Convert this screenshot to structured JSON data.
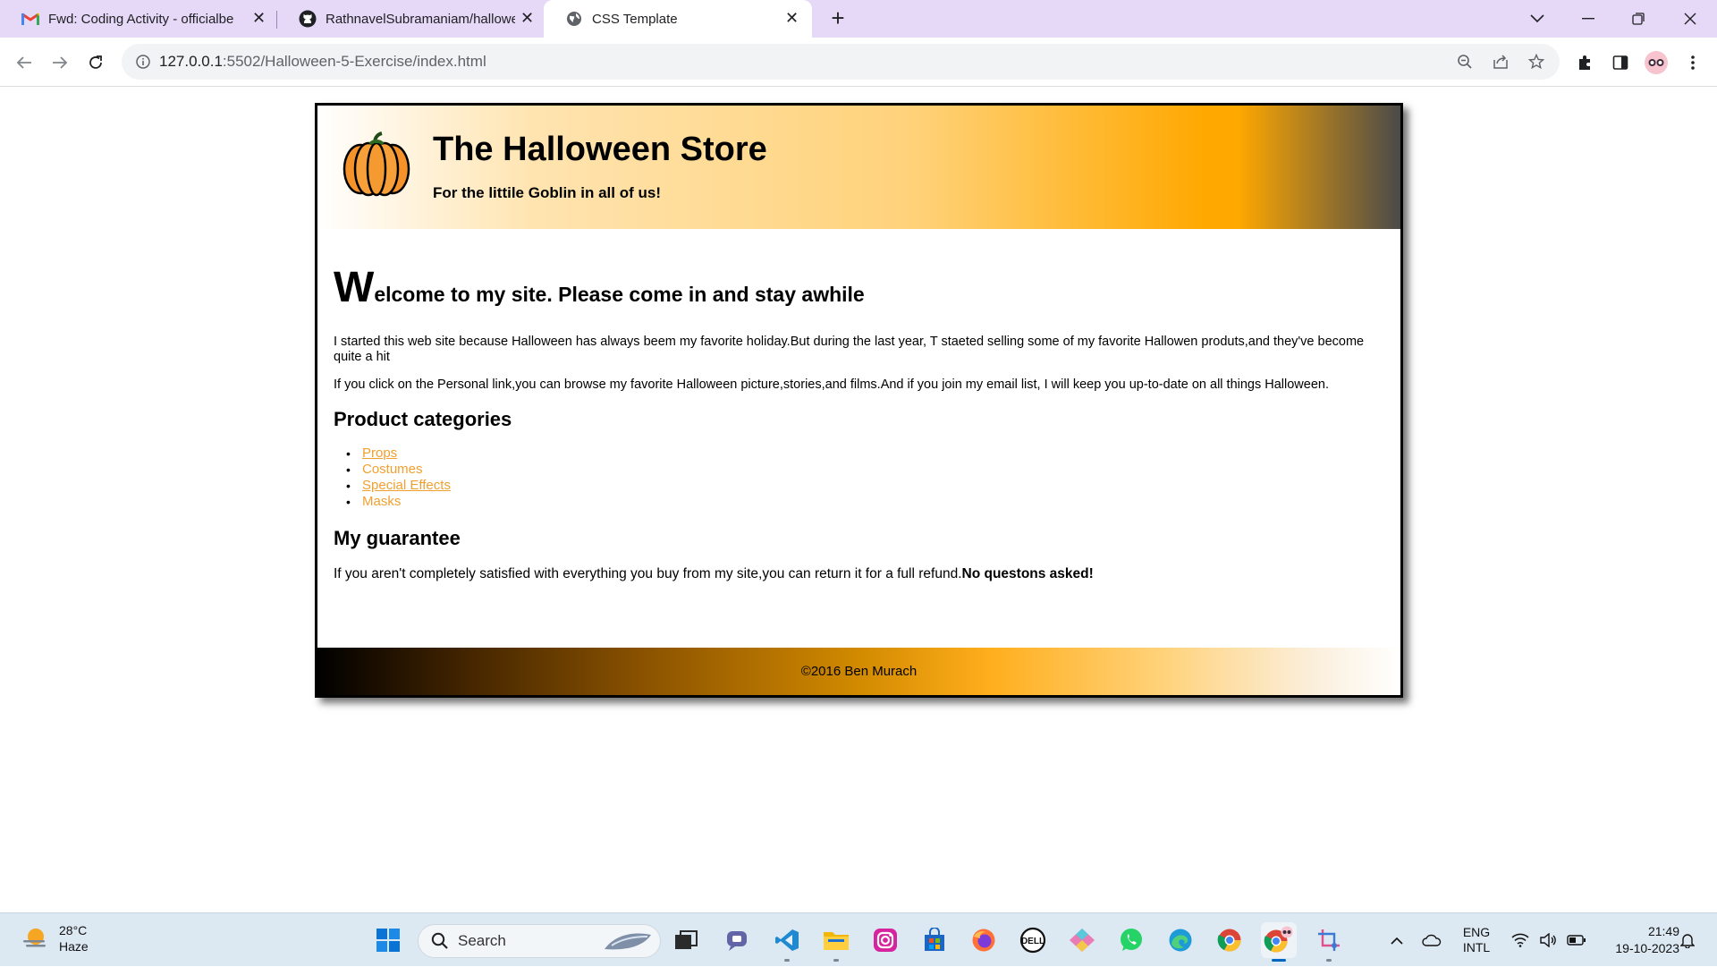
{
  "browser": {
    "tabs": [
      {
        "title": "Fwd: Coding Activity - officialbe",
        "icon": "gmail-icon",
        "active": false
      },
      {
        "title": "RathnavelSubramaniam/hallowe",
        "icon": "github-icon",
        "active": false
      },
      {
        "title": "CSS Template",
        "icon": "globe-icon",
        "active": true
      }
    ],
    "url_host": "127.0.0.1",
    "url_rest": ":5502/Halloween-5-Exercise/index.html"
  },
  "site": {
    "title": "The Halloween Store",
    "tagline": "For the littile Goblin in all of us!",
    "welcome_cap": "W",
    "welcome_rest": "elcome to my site. Please come in and stay awhile",
    "para1": "I started this web site because Halloween has always beem my favorite holiday.But during the last year, T staeted selling some of my favorite Hallowen produts,and they've become quite a hit",
    "para2": "If you click on the Personal link,you can browse my favorite Halloween picture,stories,and films.And if you join my email list, I will keep you up-to-date on all things Halloween.",
    "categories_heading": "Product categories",
    "categories": [
      {
        "label": "Props",
        "underlined": true
      },
      {
        "label": "Costumes",
        "underlined": false
      },
      {
        "label": "Special Effects",
        "underlined": true
      },
      {
        "label": "Masks",
        "underlined": false
      }
    ],
    "guarantee_heading": "My guarantee",
    "guarantee_text": "If you aren't completely satisfied with everything you buy from my site,you can return it for a full refund.",
    "guarantee_bold": "No questons asked!",
    "footer": "©2016 Ben Murach",
    "colors": {
      "link": "#f0a030",
      "header_accent": "#ffa800"
    }
  },
  "taskbar": {
    "weather_temp": "28°C",
    "weather_desc": "Haze",
    "search_placeholder": "Search",
    "lang_line1": "ENG",
    "lang_line2": "INTL",
    "time": "21:49",
    "date": "19-10-2023"
  }
}
